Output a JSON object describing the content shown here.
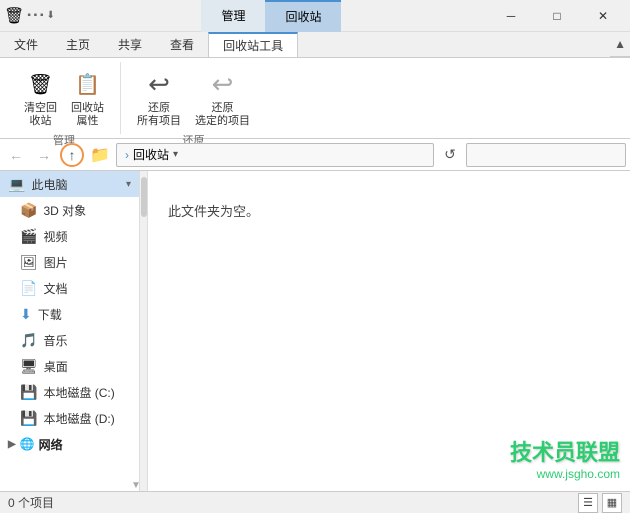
{
  "titlebar": {
    "app_title": "回收站",
    "tabs": [
      {
        "label": "管理",
        "active": false
      },
      {
        "label": "回收站",
        "active": true
      }
    ],
    "window_controls": {
      "minimize": "─",
      "maximize": "□",
      "close": "✕"
    }
  },
  "ribbon": {
    "tabs": [
      {
        "label": "文件",
        "active": false
      },
      {
        "label": "主页",
        "active": false
      },
      {
        "label": "共享",
        "active": false
      },
      {
        "label": "查看",
        "active": false
      },
      {
        "label": "回收站工具",
        "active": true
      }
    ],
    "groups": [
      {
        "label": "管理",
        "buttons": [
          {
            "icon": "🗑",
            "label": "清空回\n收站"
          },
          {
            "icon": "📋",
            "label": "回收站\n属性"
          }
        ]
      },
      {
        "label": "还原",
        "buttons": [
          {
            "icon": "↩",
            "label": "还原\n所有项目"
          },
          {
            "icon": "↩",
            "label": "还原\n选定的项目"
          }
        ]
      }
    ]
  },
  "addressbar": {
    "back_btn": "←",
    "forward_btn": "→",
    "up_btn": "↑",
    "breadcrumb": "回收站",
    "dropdown_arrow": "▾",
    "refresh_icon": "↺",
    "search_placeholder": ""
  },
  "sidebar": {
    "items": [
      {
        "icon": "💻",
        "label": "此电脑",
        "selected": true,
        "type": "header"
      },
      {
        "icon": "📦",
        "label": "3D 对象",
        "selected": false,
        "indent": true
      },
      {
        "icon": "🎬",
        "label": "视频",
        "selected": false,
        "indent": true
      },
      {
        "icon": "🖼",
        "label": "图片",
        "selected": false,
        "indent": true
      },
      {
        "icon": "📄",
        "label": "文档",
        "selected": false,
        "indent": true
      },
      {
        "icon": "⬇",
        "label": "下载",
        "selected": false,
        "indent": true,
        "color": "#4a90d0"
      },
      {
        "icon": "🎵",
        "label": "音乐",
        "selected": false,
        "indent": true
      },
      {
        "icon": "🖥",
        "label": "桌面",
        "selected": false,
        "indent": true
      },
      {
        "icon": "💾",
        "label": "本地磁盘 (C:)",
        "selected": false,
        "indent": true
      },
      {
        "icon": "💾",
        "label": "本地磁盘 (D:)",
        "selected": false,
        "indent": true
      },
      {
        "icon": "🌐",
        "label": "网络",
        "selected": false,
        "type": "section"
      }
    ],
    "collapse_arrow": "▾"
  },
  "content": {
    "empty_message": "此文件夹为空。"
  },
  "watermark": {
    "main_text": "技术员联盟",
    "url_text": "www.jsgho.com"
  },
  "statusbar": {
    "item_count": "0 个项目",
    "view_list_icon": "☰",
    "view_detail_icon": "▦"
  }
}
